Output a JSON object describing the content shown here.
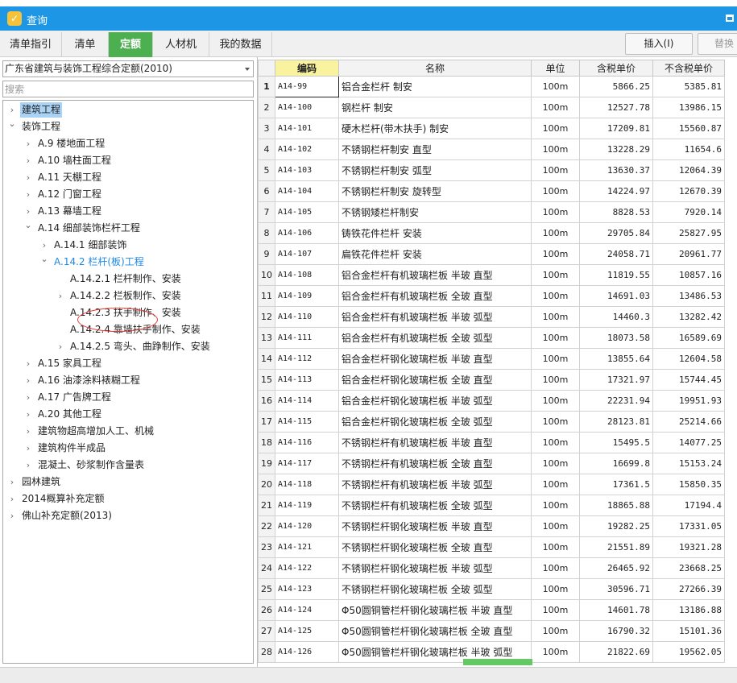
{
  "window": {
    "title": "查询"
  },
  "tabs": [
    {
      "label": "清单指引",
      "active": false
    },
    {
      "label": "清单",
      "active": false
    },
    {
      "label": "定额",
      "active": true
    },
    {
      "label": "人材机",
      "active": false
    },
    {
      "label": "我的数据",
      "active": false
    }
  ],
  "toolbar": {
    "insert_label": "插入(I)",
    "replace_label": "替换"
  },
  "left": {
    "dropdown_value": "广东省建筑与装饰工程综合定额(2010)",
    "search_placeholder": "搜索",
    "tree": [
      {
        "label": "建筑工程",
        "arrow": "collapsed",
        "level": 0,
        "selected": true
      },
      {
        "label": "装饰工程",
        "arrow": "expanded",
        "level": 0
      },
      {
        "label": "A.9 楼地面工程",
        "arrow": "collapsed",
        "level": 1
      },
      {
        "label": "A.10 墙柱面工程",
        "arrow": "collapsed",
        "level": 1
      },
      {
        "label": "A.11 天棚工程",
        "arrow": "collapsed",
        "level": 1
      },
      {
        "label": "A.12 门窗工程",
        "arrow": "collapsed",
        "level": 1
      },
      {
        "label": "A.13 幕墙工程",
        "arrow": "collapsed",
        "level": 1
      },
      {
        "label": "A.14 细部装饰栏杆工程",
        "arrow": "expanded",
        "level": 1
      },
      {
        "label": "A.14.1 细部装饰",
        "arrow": "collapsed",
        "level": 2
      },
      {
        "label": "A.14.2 栏杆(板)工程",
        "arrow": "expanded",
        "level": 2,
        "current": true
      },
      {
        "label": "A.14.2.1 栏杆制作、安装",
        "arrow": "none",
        "level": 3
      },
      {
        "label": "A.14.2.2 栏板制作、安装",
        "arrow": "collapsed",
        "level": 3
      },
      {
        "label": "A.14.2.3 扶手制作、安装",
        "arrow": "none",
        "level": 3
      },
      {
        "label": "A.14.2.4 靠墙扶手制作、安装",
        "arrow": "none",
        "level": 3
      },
      {
        "label": "A.14.2.5 弯头、曲踭制作、安装",
        "arrow": "collapsed",
        "level": 3
      },
      {
        "label": "A.15 家具工程",
        "arrow": "collapsed",
        "level": 1
      },
      {
        "label": "A.16 油漆涂料裱糊工程",
        "arrow": "collapsed",
        "level": 1
      },
      {
        "label": "A.17 广告牌工程",
        "arrow": "collapsed",
        "level": 1
      },
      {
        "label": "A.20 其他工程",
        "arrow": "collapsed",
        "level": 1
      },
      {
        "label": "建筑物超高增加人工、机械",
        "arrow": "collapsed",
        "level": 1
      },
      {
        "label": "建筑构件半成品",
        "arrow": "collapsed",
        "level": 1
      },
      {
        "label": "混凝土、砂浆制作含量表",
        "arrow": "collapsed",
        "level": 1
      },
      {
        "label": "园林建筑",
        "arrow": "collapsed",
        "level": 0
      },
      {
        "label": "2014概算补充定额",
        "arrow": "collapsed",
        "level": 0
      },
      {
        "label": "佛山补充定额(2013)",
        "arrow": "collapsed",
        "level": 0
      }
    ]
  },
  "grid": {
    "columns": [
      "编码",
      "名称",
      "单位",
      "含税单价",
      "不含税单价"
    ],
    "rows": [
      [
        "1",
        "A14-99",
        "铝合金栏杆 制安",
        "100m",
        "5866.25",
        "5385.81"
      ],
      [
        "2",
        "A14-100",
        "钢栏杆 制安",
        "100m",
        "12527.78",
        "13986.15"
      ],
      [
        "3",
        "A14-101",
        "硬木栏杆(带木扶手) 制安",
        "100m",
        "17209.81",
        "15560.87"
      ],
      [
        "4",
        "A14-102",
        "不锈钢栏杆制安 直型",
        "100m",
        "13228.29",
        "11654.6"
      ],
      [
        "5",
        "A14-103",
        "不锈钢栏杆制安 弧型",
        "100m",
        "13630.37",
        "12064.39"
      ],
      [
        "6",
        "A14-104",
        "不锈钢栏杆制安 旋转型",
        "100m",
        "14224.97",
        "12670.39"
      ],
      [
        "7",
        "A14-105",
        "不锈钢矮栏杆制安",
        "100m",
        "8828.53",
        "7920.14"
      ],
      [
        "8",
        "A14-106",
        "铸铁花件栏杆 安装",
        "100m",
        "29705.84",
        "25827.95"
      ],
      [
        "9",
        "A14-107",
        "扁铁花件栏杆 安装",
        "100m",
        "24058.71",
        "20961.77"
      ],
      [
        "10",
        "A14-108",
        "铝合金栏杆有机玻璃栏板 半玻 直型",
        "100m",
        "11819.55",
        "10857.16"
      ],
      [
        "11",
        "A14-109",
        "铝合金栏杆有机玻璃栏板 全玻 直型",
        "100m",
        "14691.03",
        "13486.53"
      ],
      [
        "12",
        "A14-110",
        "铝合金栏杆有机玻璃栏板 半玻 弧型",
        "100m",
        "14460.3",
        "13282.42"
      ],
      [
        "13",
        "A14-111",
        "铝合金栏杆有机玻璃栏板 全玻 弧型",
        "100m",
        "18073.58",
        "16589.69"
      ],
      [
        "14",
        "A14-112",
        "铝合金栏杆钢化玻璃栏板 半玻 直型",
        "100m",
        "13855.64",
        "12604.58"
      ],
      [
        "15",
        "A14-113",
        "铝合金栏杆钢化玻璃栏板 全玻 直型",
        "100m",
        "17321.97",
        "15744.45"
      ],
      [
        "16",
        "A14-114",
        "铝合金栏杆钢化玻璃栏板 半玻 弧型",
        "100m",
        "22231.94",
        "19951.93"
      ],
      [
        "17",
        "A14-115",
        "铝合金栏杆钢化玻璃栏板 全玻 弧型",
        "100m",
        "28123.81",
        "25214.66"
      ],
      [
        "18",
        "A14-116",
        "不锈钢栏杆有机玻璃栏板 半玻 直型",
        "100m",
        "15495.5",
        "14077.25"
      ],
      [
        "19",
        "A14-117",
        "不锈钢栏杆有机玻璃栏板 全玻 直型",
        "100m",
        "16699.8",
        "15153.24"
      ],
      [
        "20",
        "A14-118",
        "不锈钢栏杆有机玻璃栏板 半玻 弧型",
        "100m",
        "17361.5",
        "15850.35"
      ],
      [
        "21",
        "A14-119",
        "不锈钢栏杆有机玻璃栏板 全玻 弧型",
        "100m",
        "18865.88",
        "17194.4"
      ],
      [
        "22",
        "A14-120",
        "不锈钢栏杆钢化玻璃栏板 半玻 直型",
        "100m",
        "19282.25",
        "17331.05"
      ],
      [
        "23",
        "A14-121",
        "不锈钢栏杆钢化玻璃栏板 全玻 直型",
        "100m",
        "21551.89",
        "19321.28"
      ],
      [
        "24",
        "A14-122",
        "不锈钢栏杆钢化玻璃栏板 半玻 弧型",
        "100m",
        "26465.92",
        "23668.25"
      ],
      [
        "25",
        "A14-123",
        "不锈钢栏杆钢化玻璃栏板 全玻 弧型",
        "100m",
        "30596.71",
        "27266.39"
      ],
      [
        "26",
        "A14-124",
        "Φ50圆铜管栏杆钢化玻璃栏板 半玻 直型",
        "100m",
        "14601.78",
        "13186.88"
      ],
      [
        "27",
        "A14-125",
        "Φ50圆铜管栏杆钢化玻璃栏板 全玻 直型",
        "100m",
        "16790.32",
        "15101.36"
      ],
      [
        "28",
        "A14-126",
        "Φ50圆铜管栏杆钢化玻璃栏板 半玻 弧型",
        "100m",
        "21822.69",
        "19562.05"
      ]
    ]
  },
  "colors": {
    "titlebar": "#1e96e6",
    "active_tab": "#4caf50",
    "tree_selection": "#a9d2f5",
    "current_node": "#1e88e5",
    "annotation_circle": "#e53935",
    "header_highlight": "#f9f3a0"
  }
}
